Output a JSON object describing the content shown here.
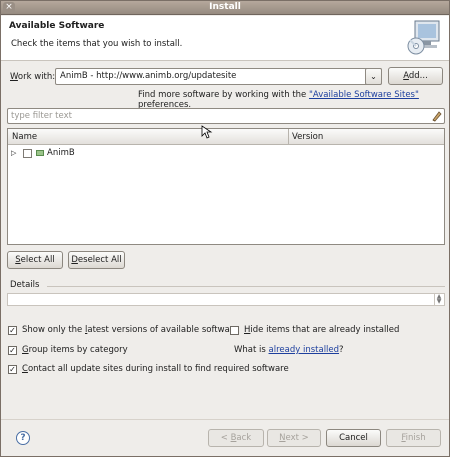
{
  "window": {
    "title": "Install",
    "close_glyph": "×"
  },
  "header": {
    "title": "Available Software",
    "description": "Check the items that you wish to install.",
    "icon": "install-wizard-icon"
  },
  "work_with": {
    "label_prefix": "W",
    "label_rest": "ork with:",
    "value": "AnimB - http://www.animb.org/updatesite",
    "dropdown_glyph": "⌄",
    "add_button_prefix": "A",
    "add_button_rest": "dd..."
  },
  "find_more": {
    "prefix": "Find more software by working with the ",
    "link": "\"Available Software Sites\"",
    "suffix": " preferences."
  },
  "filter": {
    "placeholder": "type filter text",
    "clear_icon": "eraser-icon"
  },
  "table": {
    "columns": [
      "Name",
      "Version"
    ],
    "rows": [
      {
        "name": "AnimB",
        "version": "",
        "expander": "▷",
        "checked": false
      }
    ]
  },
  "selection_buttons": {
    "select_all_prefix": "S",
    "select_all_rest": "elect All",
    "deselect_all_prefix": "D",
    "deselect_all_rest": "eselect All"
  },
  "details": {
    "label": "Details",
    "value": ""
  },
  "options": {
    "latest": {
      "pre": "Show only the ",
      "mnemonic": "l",
      "post": "atest versions of available software",
      "checked": true
    },
    "hide_installed": {
      "mnemonic": "H",
      "post": "ide items that are already installed",
      "checked": false
    },
    "group": {
      "mnemonic": "G",
      "post": "roup items by category",
      "checked": true
    },
    "what_is": {
      "prefix": "What is ",
      "link": "already installed",
      "suffix": "?"
    },
    "contact": {
      "mnemonic": "C",
      "post": "ontact all update sites during install to find required software",
      "checked": true
    }
  },
  "footer": {
    "help_glyph": "?",
    "back_pre": "< ",
    "back_mnemonic": "B",
    "back_post": "ack",
    "next_mnemonic": "N",
    "next_post": "ext >",
    "cancel": "Cancel",
    "finish_mnemonic": "F",
    "finish_post": "inish"
  },
  "colors": {
    "link": "#1d3f9e",
    "title_bar": "#a89c91",
    "background": "#efedea"
  }
}
